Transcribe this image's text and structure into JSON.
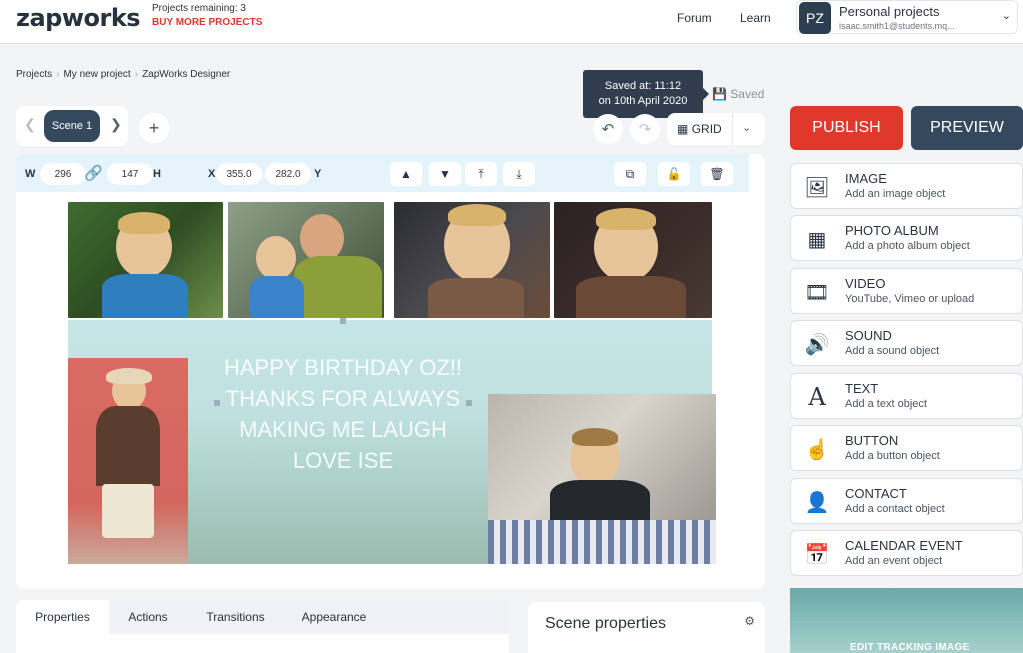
{
  "app": {
    "logo": "zapworks",
    "projects_remaining": "Projects remaining: 3",
    "buy_more": "BUY MORE PROJECTS",
    "nav": [
      "Forum",
      "Learn"
    ],
    "account": {
      "initials": "PZ",
      "name": "Personal projects",
      "email": "isaac.smith1@students.mq..."
    }
  },
  "breadcrumb": [
    "Projects",
    "My new project",
    "ZapWorks Designer"
  ],
  "tooltip": {
    "line1": "Saved at: 11:12",
    "line2": "on 10th April 2020"
  },
  "saved_status": "Saved",
  "scene_nav": {
    "current": "Scene 1"
  },
  "toolbar": {
    "w_label": "W",
    "w_value": "296",
    "h_label": "H",
    "h_value": "147",
    "x_label": "X",
    "x_value": "355.0",
    "y_label": "Y",
    "y_value": "282.0",
    "grid_label": "GRID"
  },
  "canvas_text": [
    "HAPPY BIRTHDAY OZ!!",
    "THANKS FOR ALWAYS",
    "MAKING ME LAUGH",
    "LOVE ISE"
  ],
  "bottom_tabs": [
    "Properties",
    "Actions",
    "Transitions",
    "Appearance"
  ],
  "scene_properties": "Scene properties",
  "publish_label": "PUBLISH",
  "preview_label": "PREVIEW",
  "objects": [
    {
      "title": "IMAGE",
      "sub": "Add an image object",
      "icon": "image-icon"
    },
    {
      "title": "PHOTO ALBUM",
      "sub": "Add a photo album object",
      "icon": "grid-icon"
    },
    {
      "title": "VIDEO",
      "sub": "YouTube, Vimeo or upload",
      "icon": "film-icon"
    },
    {
      "title": "SOUND",
      "sub": "Add a sound object",
      "icon": "speaker-icon"
    },
    {
      "title": "TEXT",
      "sub": "Add a text object",
      "icon": "text-icon"
    },
    {
      "title": "BUTTON",
      "sub": "Add a button object",
      "icon": "pointer-icon"
    },
    {
      "title": "CONTACT",
      "sub": "Add a contact object",
      "icon": "person-icon"
    },
    {
      "title": "CALENDAR EVENT",
      "sub": "Add an event object",
      "icon": "calendar-icon"
    }
  ],
  "tracking_label": "EDIT TRACKING IMAGE",
  "colors": {
    "publish": "#e0392b",
    "preview": "#34495e",
    "accent": "#e0392b"
  }
}
